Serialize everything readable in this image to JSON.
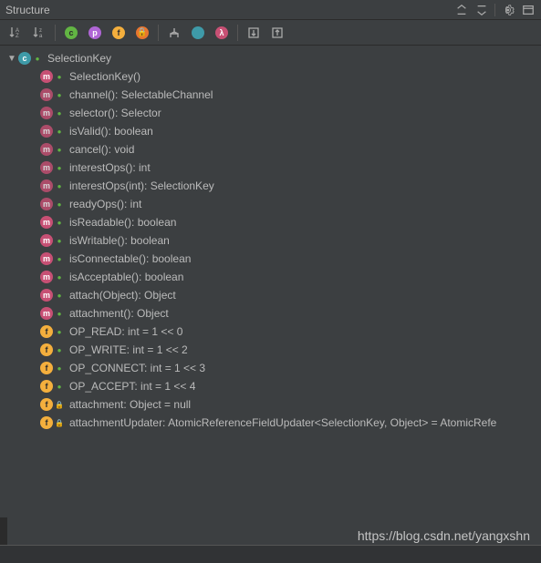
{
  "panel": {
    "title": "Structure"
  },
  "toolbar": {
    "sort_alpha": "↓A",
    "sort_visibility": "↓z",
    "class_icon": "c",
    "properties_icon": "p",
    "fields_icon": "f",
    "lock_icon": "🔒",
    "inherited_icon": "Y",
    "anon_icon": "●",
    "lambda_icon": "λ",
    "expand_icon": "⤢",
    "collapse_icon": "⤡"
  },
  "root": {
    "label": "SelectionKey",
    "icon_letter": "c"
  },
  "members": [
    {
      "icon": "method",
      "letter": "m",
      "vis": "public",
      "abs": false,
      "label": "SelectionKey()"
    },
    {
      "icon": "method",
      "letter": "m",
      "vis": "public",
      "abs": true,
      "label": "channel(): SelectableChannel"
    },
    {
      "icon": "method",
      "letter": "m",
      "vis": "public",
      "abs": true,
      "label": "selector(): Selector"
    },
    {
      "icon": "method",
      "letter": "m",
      "vis": "public",
      "abs": true,
      "label": "isValid(): boolean"
    },
    {
      "icon": "method",
      "letter": "m",
      "vis": "public",
      "abs": true,
      "label": "cancel(): void"
    },
    {
      "icon": "method",
      "letter": "m",
      "vis": "public",
      "abs": true,
      "label": "interestOps(): int"
    },
    {
      "icon": "method",
      "letter": "m",
      "vis": "public",
      "abs": true,
      "label": "interestOps(int): SelectionKey"
    },
    {
      "icon": "method",
      "letter": "m",
      "vis": "public",
      "abs": true,
      "label": "readyOps(): int"
    },
    {
      "icon": "method",
      "letter": "m",
      "vis": "public",
      "abs": false,
      "label": "isReadable(): boolean"
    },
    {
      "icon": "method",
      "letter": "m",
      "vis": "public",
      "abs": false,
      "label": "isWritable(): boolean"
    },
    {
      "icon": "method",
      "letter": "m",
      "vis": "public",
      "abs": false,
      "label": "isConnectable(): boolean"
    },
    {
      "icon": "method",
      "letter": "m",
      "vis": "public",
      "abs": false,
      "label": "isAcceptable(): boolean"
    },
    {
      "icon": "method",
      "letter": "m",
      "vis": "public",
      "abs": false,
      "label": "attach(Object): Object"
    },
    {
      "icon": "method",
      "letter": "m",
      "vis": "public",
      "abs": false,
      "label": "attachment(): Object"
    },
    {
      "icon": "field",
      "letter": "f",
      "vis": "public",
      "abs": false,
      "label": "OP_READ: int = 1 << 0"
    },
    {
      "icon": "field",
      "letter": "f",
      "vis": "public",
      "abs": false,
      "label": "OP_WRITE: int = 1 << 2"
    },
    {
      "icon": "field",
      "letter": "f",
      "vis": "public",
      "abs": false,
      "label": "OP_CONNECT: int = 1 << 3"
    },
    {
      "icon": "field",
      "letter": "f",
      "vis": "public",
      "abs": false,
      "label": "OP_ACCEPT: int = 1 << 4"
    },
    {
      "icon": "field",
      "letter": "f",
      "vis": "private",
      "abs": false,
      "label": "attachment: Object = null"
    },
    {
      "icon": "field",
      "letter": "f",
      "vis": "private",
      "abs": false,
      "label": "attachmentUpdater: AtomicReferenceFieldUpdater<SelectionKey, Object> = AtomicRefe"
    }
  ],
  "watermark": "https://blog.csdn.net/yangxshn"
}
